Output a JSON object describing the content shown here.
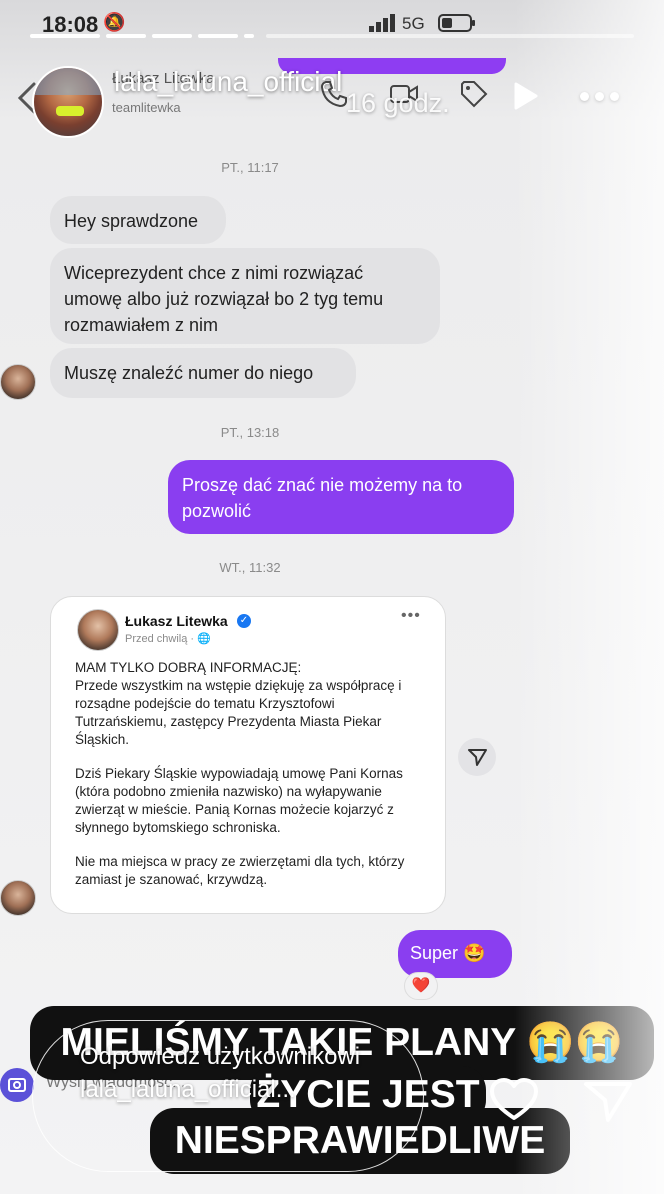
{
  "status_bar": {
    "time": "18:08",
    "network": "5G"
  },
  "header": {
    "contact_name": "Łukasz Litewka",
    "contact_handle": "teamlitewka",
    "story_user": "lala_laluna_official",
    "story_time": "16 godz."
  },
  "chat": {
    "timestamps": [
      "PT., 11:17",
      "PT., 13:18",
      "WT., 11:32"
    ],
    "messages": {
      "m1": "Hey sprawdzone",
      "m2": "Wiceprezydent chce z nimi rozwiązać umowę albo już rozwiązał bo 2 tyg temu rozmawiałem z nim",
      "m3": "Muszę znaleźć numer do niego",
      "m4": "Proszę dać znać nie możemy na to pozwolić",
      "m5": "Super 🤩"
    },
    "reaction": "❤️",
    "shared_post": {
      "author": "Łukasz Litewka",
      "meta": "Przed chwilą · 🌐",
      "more": "•••",
      "paragraphs": [
        "MAM TYLKO DOBRĄ INFORMACJĘ:\nPrzede wszystkim na wstępie dziękuję za współpracę i rozsądne podejście do tematu Krzysztofowi Tutrzańskiemu, zastępcy Prezydenta Miasta Piekar Śląskich.",
        "Dziś Piekary Śląskie wypowiadają umowę Pani Kornas (która podobno zmieniła nazwisko) na wyłapywanie zwierząt w mieście. Panią Kornas możecie kojarzyć z słynnego bytomskiego schroniska.",
        "Nie ma miejsca w pracy ze zwierzętami dla tych, którzy zamiast je szanować, krzywdzą."
      ]
    },
    "input_placeholder": "Wyślij wiadomość..."
  },
  "story_caption": {
    "line1": "MIELIŚMY TAKIE PLANY 😭😭",
    "line2": "ŻYCIE JEST",
    "line3": "NIESPRAWIEDLIWE"
  },
  "reply": {
    "placeholder": "Odpowiedz użytkownikowi lala_laluna_official..."
  },
  "colors": {
    "accent_purple": "#8a3ef0",
    "bubble_gray": "#e2e2e4",
    "caption_bg": "#111111"
  }
}
